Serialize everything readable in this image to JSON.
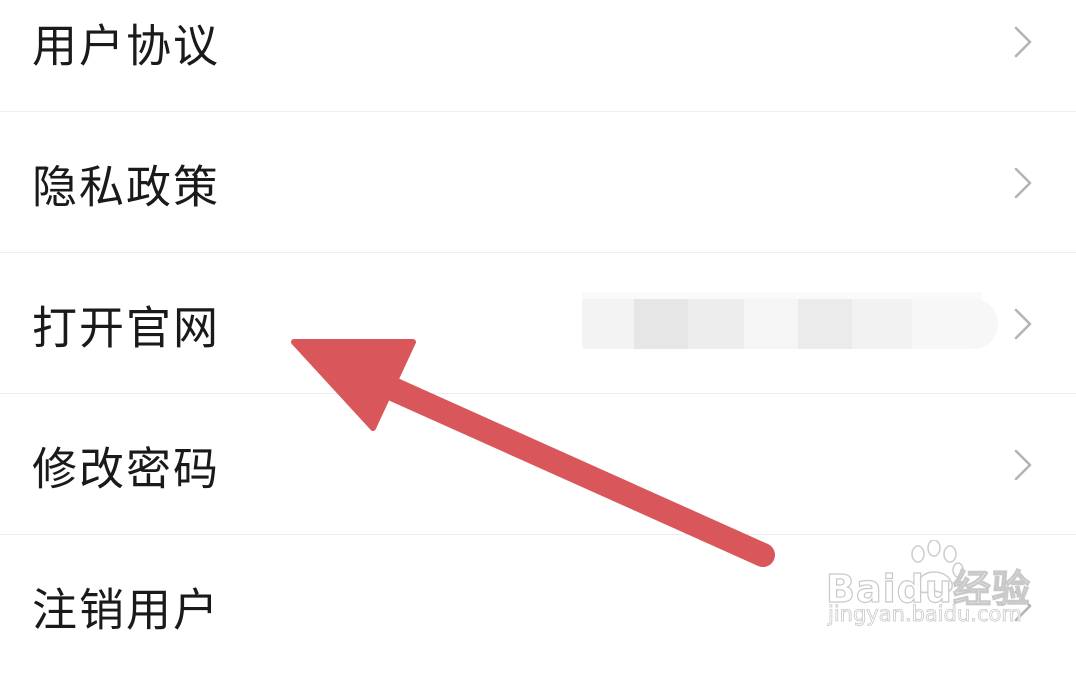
{
  "menu": {
    "items": [
      {
        "label": "用户协议"
      },
      {
        "label": "隐私政策"
      },
      {
        "label": "打开官网"
      },
      {
        "label": "修改密码"
      },
      {
        "label": "注销用户"
      }
    ]
  },
  "icons": {
    "chevron": "chevron-right-icon",
    "arrow": "red-arrow-annotation",
    "watermark_logo": "baidu-paw-icon"
  },
  "colors": {
    "arrow": "#d9575a",
    "label_text": "#1a1a1a",
    "chevron": "#b5b5b5",
    "divider": "#efefef"
  },
  "watermark": {
    "brand": "Baidu经验",
    "domain": "jingyan.baidu.com"
  }
}
